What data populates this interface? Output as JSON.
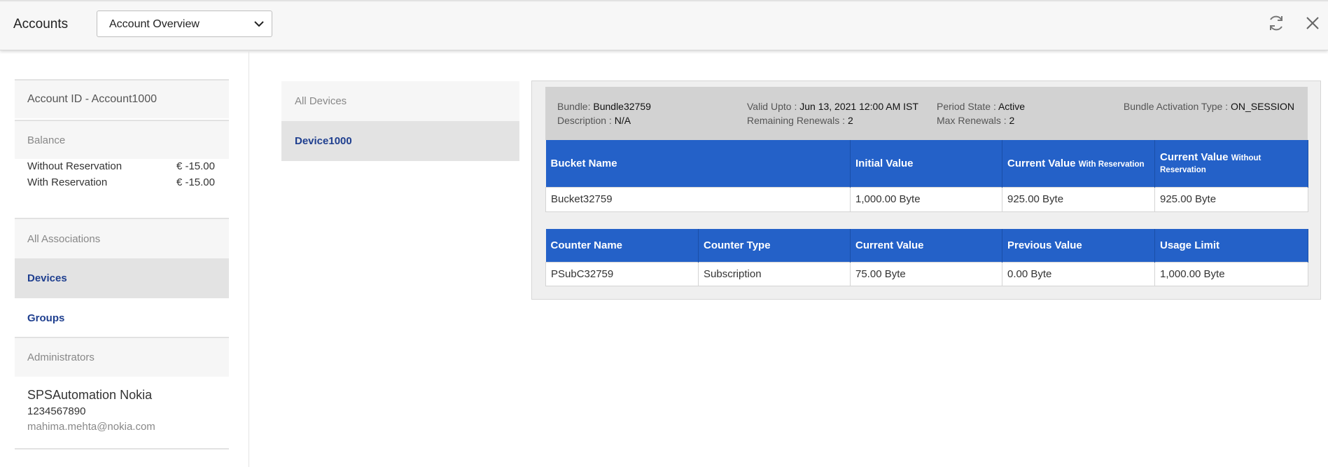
{
  "header": {
    "title": "Accounts",
    "view_select": "Account Overview"
  },
  "account": {
    "id_label": "Account ID - Account1000",
    "balance_heading": "Balance",
    "balances": [
      {
        "label": "Without Reservation",
        "amount": "€ -15.00"
      },
      {
        "label": "With Reservation",
        "amount": "€ -15.00"
      }
    ],
    "associations_heading": "All Associations",
    "nav": [
      {
        "label": "Devices"
      },
      {
        "label": "Groups"
      }
    ],
    "administrators_heading": "Administrators",
    "admin": {
      "name": "SPSAutomation Nokia",
      "phone": "1234567890",
      "email": "mahima.mehta@nokia.com"
    }
  },
  "devices": {
    "heading": "All Devices",
    "items": [
      "Device1000"
    ]
  },
  "bundle": {
    "bundle_label": "Bundle:",
    "bundle_value": "Bundle32759",
    "description_label": "Description :",
    "description_value": "N/A",
    "valid_upto_label": "Valid Upto :",
    "valid_upto_value": "Jun 13, 2021 12:00 AM IST",
    "remaining_renewals_label": "Remaining Renewals :",
    "remaining_renewals_value": "2",
    "period_state_label": "Period State :",
    "period_state_value": "Active",
    "max_renewals_label": "Max Renewals :",
    "max_renewals_value": "2",
    "activation_type_label": "Bundle Activation Type :",
    "activation_type_value": "ON_SESSION"
  },
  "buckets": {
    "headers": {
      "name": "Bucket Name",
      "initial": "Initial Value",
      "current_with": "Current Value",
      "current_with_small": "With Reservation",
      "current_without": "Current Value",
      "current_without_small": "Without Reservation"
    },
    "rows": [
      {
        "name": "Bucket32759",
        "initial": "1,000.00 Byte",
        "current_with": "925.00 Byte",
        "current_without": "925.00 Byte"
      }
    ]
  },
  "counters": {
    "headers": {
      "name": "Counter Name",
      "type": "Counter Type",
      "current": "Current Value",
      "previous": "Previous Value",
      "limit": "Usage Limit"
    },
    "rows": [
      {
        "name": "PSubC32759",
        "type": "Subscription",
        "current": "75.00 Byte",
        "previous": "0.00 Byte",
        "limit": "1,000.00 Byte"
      }
    ]
  }
}
